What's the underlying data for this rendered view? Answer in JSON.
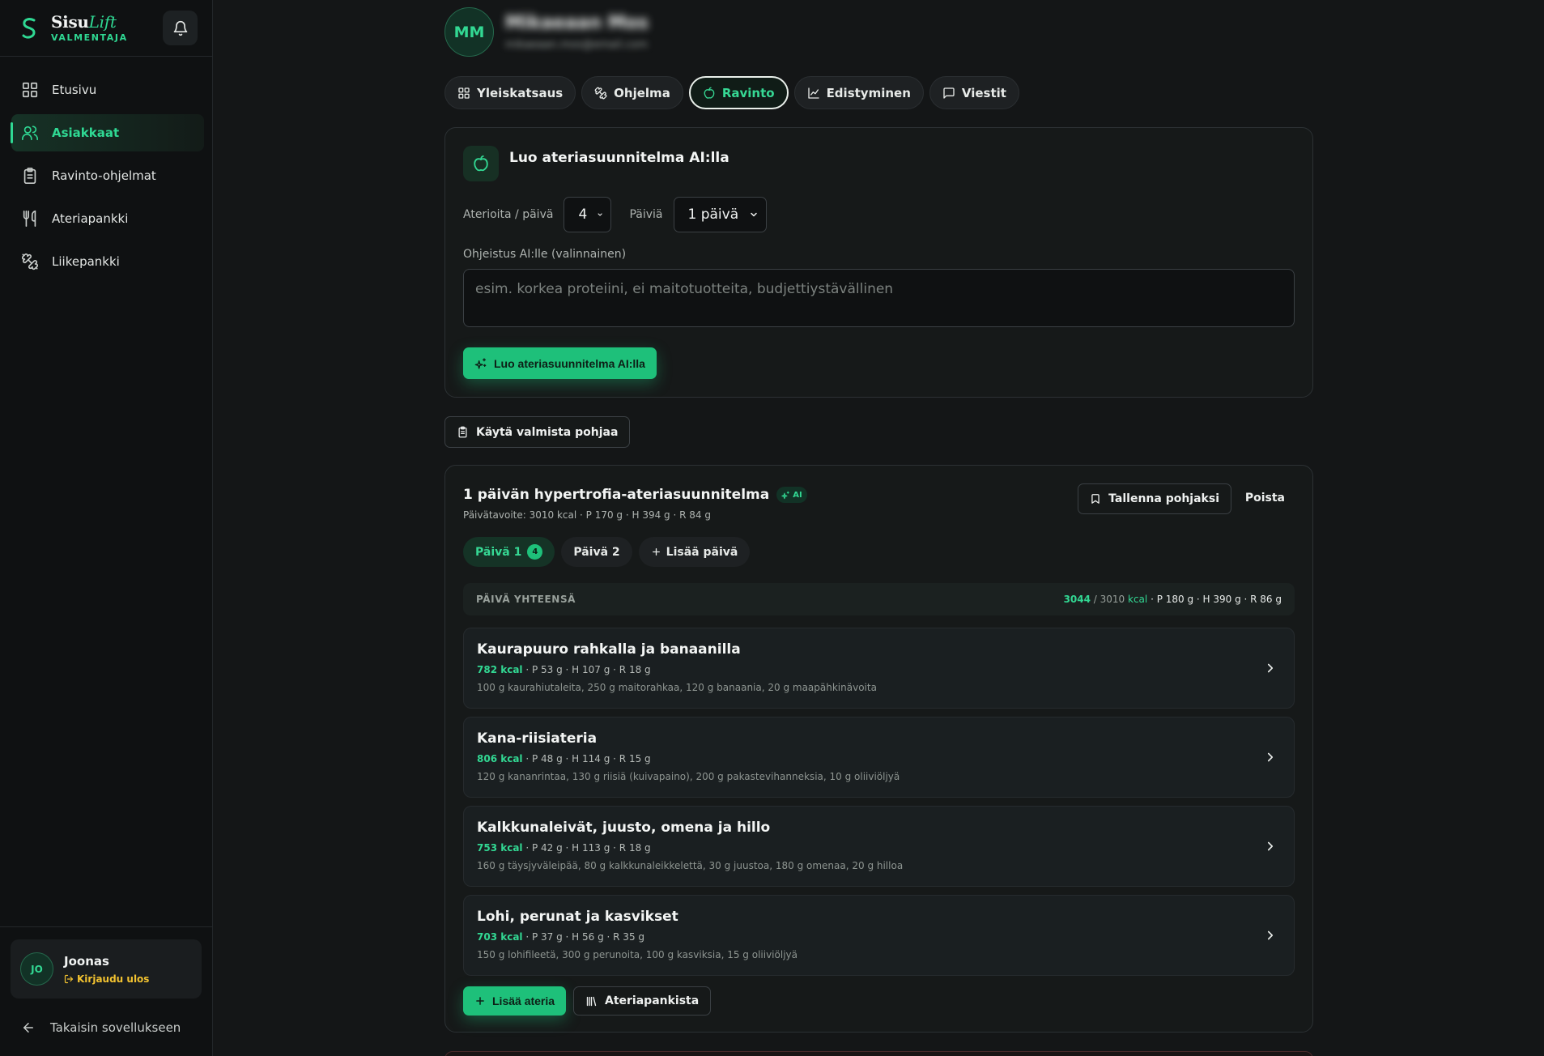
{
  "brand": {
    "name": "Sisu",
    "name_accent": "Lift",
    "subtitle": "VALMENTAJA",
    "accent": "#2fd893"
  },
  "sidebar": {
    "items": [
      {
        "label": "Etusivu",
        "icon": "grid-icon",
        "active": false
      },
      {
        "label": "Asiakkaat",
        "icon": "users-icon",
        "active": true
      },
      {
        "label": "Ravinto-ohjelmat",
        "icon": "clipboard-icon",
        "active": false
      },
      {
        "label": "Ateriapankki",
        "icon": "utensils-icon",
        "active": false
      },
      {
        "label": "Liikepankki",
        "icon": "dumbbell-icon",
        "active": false
      }
    ],
    "user": {
      "initials": "JO",
      "name": "Joonas",
      "logout_label": "Kirjaudu ulos"
    },
    "back_label": "Takaisin sovellukseen"
  },
  "client": {
    "initials": "MM",
    "name": "Mikaeaan Mos",
    "email": "mikaeaan.mos@email.com"
  },
  "tabs": [
    {
      "label": "Yleiskatsaus",
      "icon": "grid-icon"
    },
    {
      "label": "Ohjelma",
      "icon": "dumbbell-icon"
    },
    {
      "label": "Ravinto",
      "icon": "apple-icon"
    },
    {
      "label": "Edistyminen",
      "icon": "line-chart-icon"
    },
    {
      "label": "Viestit",
      "icon": "message-icon"
    }
  ],
  "active_tab": "Ravinto",
  "ai_generator": {
    "title": "Luo ateriasuunnitelma AI:lla",
    "meals_label": "Aterioita / päivä",
    "meals_value": "4",
    "days_label": "Päiviä",
    "days_value": "1 päivä",
    "prompt_label": "Ohjeistus AI:lle (valinnainen)",
    "prompt_placeholder": "esim. korkea proteiini, ei maitotuotteita, budjettiystävällinen",
    "prompt_value": "",
    "generate_label": "Luo ateriasuunnitelma AI:lla"
  },
  "template_button_label": "Käytä valmista pohjaa",
  "plan": {
    "title": "1 päivän hypertrofia-ateriasuunnitelma",
    "ai_badge": "AI",
    "target": "Päivätavoite: 3010 kcal · P 170 g · H 394 g · R 84 g",
    "save_template_label": "Tallenna pohjaksi",
    "delete_label": "Poista",
    "day_tabs": [
      {
        "label": "Päivä 1",
        "count": "4",
        "active": true
      },
      {
        "label": "Päivä 2",
        "count": "",
        "active": false
      }
    ],
    "add_day_label": "Lisää päivä",
    "day_total": {
      "label": "PÄIVÄ YHTEENSÄ",
      "kcal": "3044",
      "sep": " / ",
      "target": "3010",
      "unit": " kcal",
      "macros": " · P 180 g · H 390 g · R 86 g"
    },
    "meals": [
      {
        "name": "Kaurapuuro rahkalla ja banaanilla",
        "kcal": "782 kcal",
        "macros": " · P 53 g · H 107 g · R 18 g",
        "ingredients": "100 g kaurahiutaleita, 250 g maitorahkaa, 120 g banaania, 20 g maapähkinävoita"
      },
      {
        "name": "Kana-riisiateria",
        "kcal": "806 kcal",
        "macros": " · P 48 g · H 114 g · R 15 g",
        "ingredients": "120 g kananrintaa, 130 g riisiä (kuivapaino), 200 g pakastevihanneksia, 10 g oliiviöljyä"
      },
      {
        "name": "Kalkkunaleivät, juusto, omena ja hillo",
        "kcal": "753 kcal",
        "macros": " · P 42 g · H 113 g · R 18 g",
        "ingredients": "160 g täysjyväleipää, 80 g kalkkunaleikkelettä, 30 g juustoa, 180 g omenaa, 20 g hilloa"
      },
      {
        "name": "Lohi, perunat ja kasvikset",
        "kcal": "703 kcal",
        "macros": " · P 37 g · H 56 g · R 35 g",
        "ingredients": "150 g lohifileetä, 300 g perunoita, 100 g kasviksia, 15 g oliiviöljyä"
      }
    ],
    "add_meal_label": "Lisää ateria",
    "meal_bank_label": "Ateriapankista"
  }
}
